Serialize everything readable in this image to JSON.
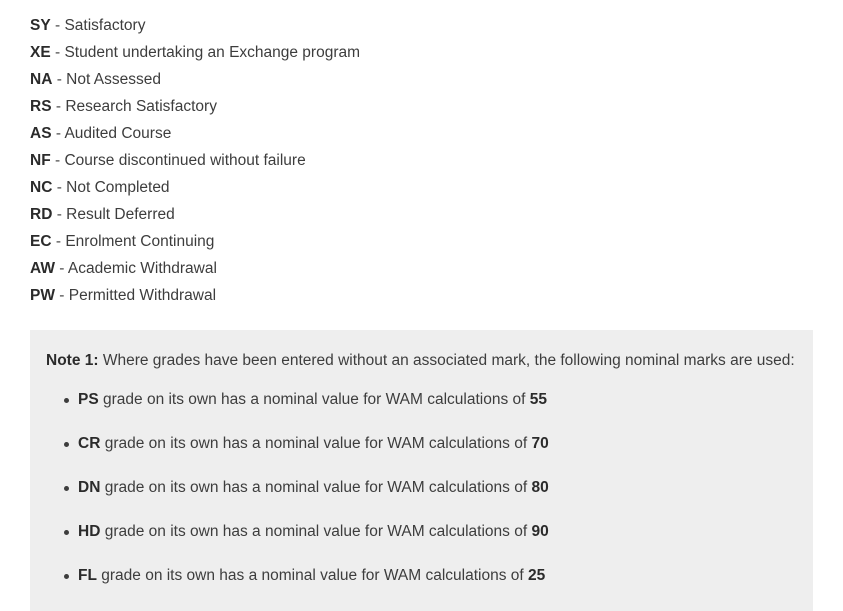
{
  "grade_legend": {
    "separator": " - ",
    "items": [
      {
        "code": "SY",
        "description": "Satisfactory"
      },
      {
        "code": "XE",
        "description": "Student undertaking an Exchange program"
      },
      {
        "code": "NA",
        "description": "Not Assessed"
      },
      {
        "code": "RS",
        "description": "Research Satisfactory"
      },
      {
        "code": "AS",
        "description": "Audited Course"
      },
      {
        "code": "NF",
        "description": "Course discontinued without failure"
      },
      {
        "code": "NC",
        "description": "Not Completed"
      },
      {
        "code": "RD",
        "description": "Result Deferred"
      },
      {
        "code": "EC",
        "description": "Enrolment Continuing"
      },
      {
        "code": "AW",
        "description": "Academic Withdrawal"
      },
      {
        "code": "PW",
        "description": "Permitted Withdrawal"
      }
    ]
  },
  "note": {
    "label": "Note 1:",
    "text": " Where grades have been entered without an associated mark, the following nominal marks are used:",
    "bullets": [
      {
        "code": "PS",
        "text": " grade on its own has a nominal value for WAM calculations of ",
        "value": "55"
      },
      {
        "code": "CR",
        "text": " grade on its own has a nominal value for WAM calculations of ",
        "value": "70"
      },
      {
        "code": "DN",
        "text": " grade on its own has a nominal value for WAM calculations of ",
        "value": "80"
      },
      {
        "code": "HD",
        "text": " grade on its own has a nominal value for WAM calculations of ",
        "value": "90"
      },
      {
        "code": "FL",
        "text": " grade on its own has a nominal value for WAM calculations of ",
        "value": "25"
      }
    ]
  },
  "colors": {
    "page_background": "#ffffff",
    "note_background": "#eeeeee",
    "body_text": "#3d3d3d",
    "bold_text": "#2b2b2b"
  }
}
